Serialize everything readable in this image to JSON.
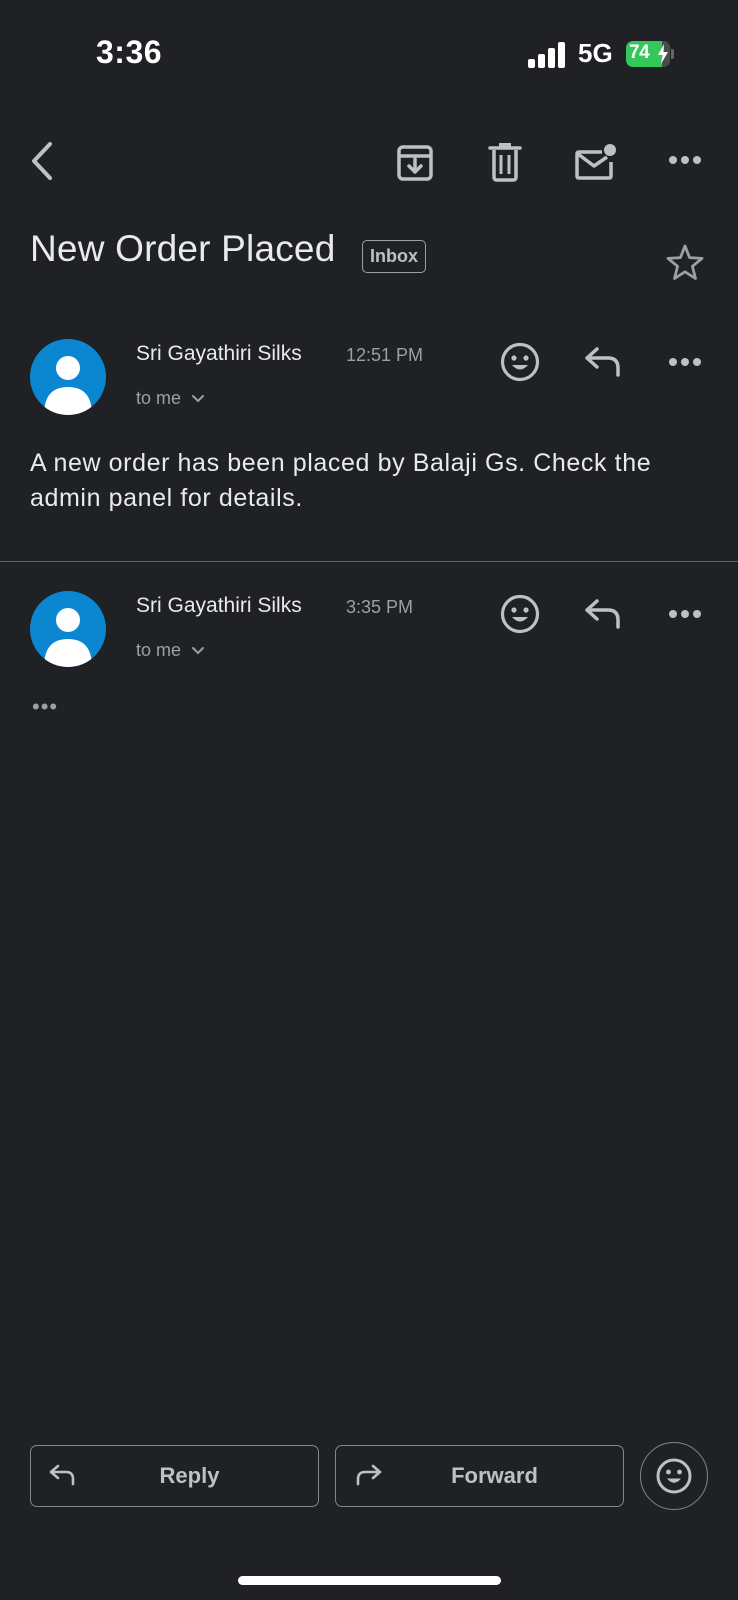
{
  "status_bar": {
    "time": "3:36",
    "network": "5G",
    "battery": "74"
  },
  "toolbar": {
    "back_icon": "chevron-left-icon",
    "archive_icon": "archive-icon",
    "delete_icon": "trash-icon",
    "mark_unread_icon": "mail-unread-icon",
    "more_icon": "more-horizontal-icon"
  },
  "thread": {
    "subject": "New Order Placed",
    "label": "Inbox",
    "starred": false
  },
  "messages": [
    {
      "sender": "Sri Gayathiri Silks",
      "time": "12:51 PM",
      "recipient": "to me",
      "body": "A new order has been placed by Balaji Gs. Check the admin panel for details."
    },
    {
      "sender": "Sri Gayathiri Silks",
      "time": "3:35 PM",
      "recipient": "to me",
      "collapsed_indicator": "•••"
    }
  ],
  "actions": {
    "reply_label": "Reply",
    "forward_label": "Forward"
  },
  "colors": {
    "background": "#202124",
    "avatar": "#0b86d1",
    "battery": "#34c759"
  }
}
